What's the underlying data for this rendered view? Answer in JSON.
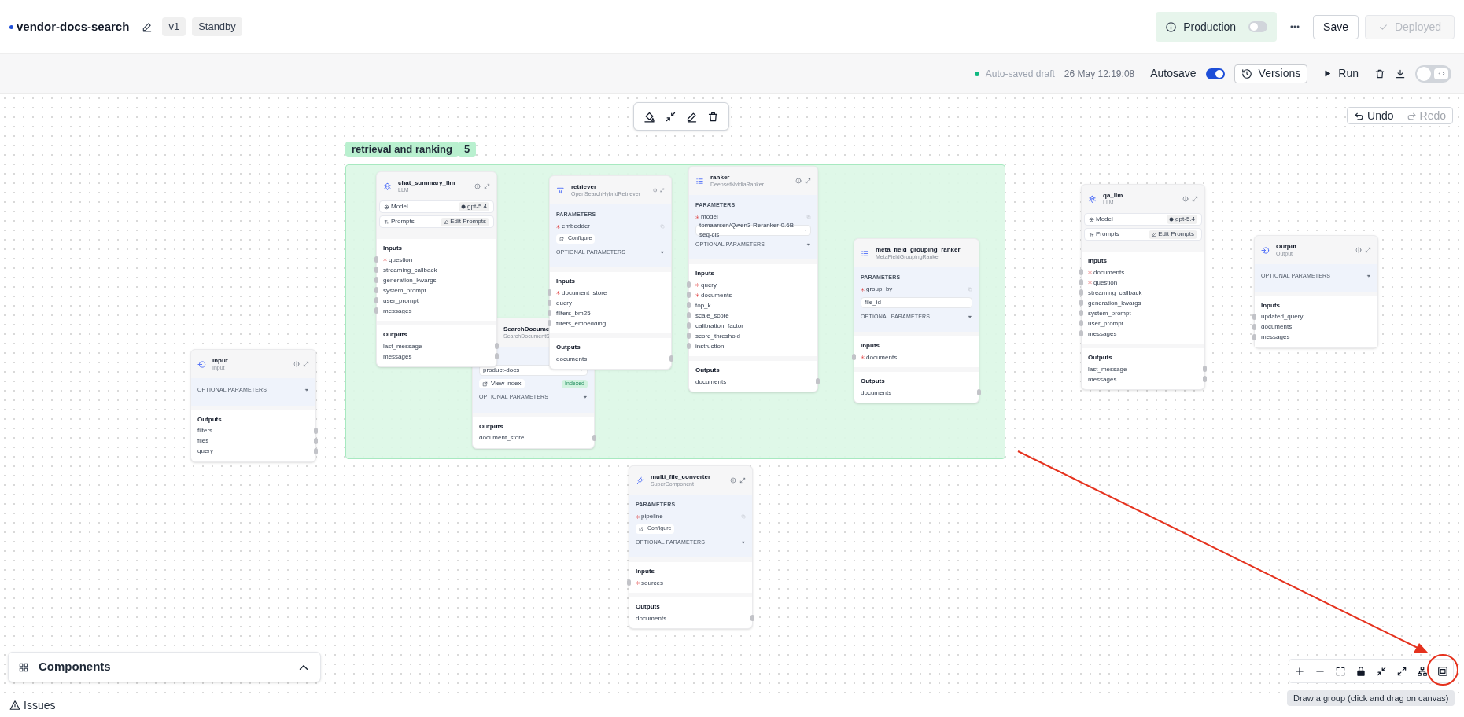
{
  "header": {
    "pipeline_name": "vendor-docs-search",
    "version": "v1",
    "status": "Standby",
    "production": {
      "label": "Production",
      "on": false
    },
    "save": "Save",
    "deploy": {
      "label": "Deployed",
      "disabled": true
    }
  },
  "toolbar": {
    "autosave_status": "Auto-saved draft",
    "saved_at": "26 May 12:19:08",
    "autosave": {
      "label": "Autosave",
      "on": true
    },
    "versions": "Versions",
    "run": "Run",
    "code_view": {
      "on": false
    }
  },
  "canvas": {
    "group": {
      "label": "retrieval and ranking",
      "count": "5"
    },
    "undo": {
      "label": "Undo",
      "disabled": false
    },
    "redo": {
      "label": "Redo",
      "disabled": true
    },
    "nodes": [
      {
        "kind": "input",
        "title": "Input",
        "subtitle": "Input",
        "optional_parameters": "OPTIONAL PARAMETERS",
        "outputs": {
          "heading": "Outputs",
          "ports": [
            "filters",
            "files",
            "query"
          ]
        }
      },
      {
        "kind": "llm",
        "title": "chat_summary_llm",
        "subtitle": "LLM",
        "model": {
          "label": "Model",
          "value": "gpt-5.4"
        },
        "prompts": {
          "label": "Prompts",
          "button": "Edit Prompts"
        },
        "inputs": {
          "heading": "Inputs",
          "ports": [
            {
              "name": "question",
              "required": true
            },
            {
              "name": "streaming_callback",
              "required": false
            },
            {
              "name": "generation_kwargs",
              "required": false
            },
            {
              "name": "system_prompt",
              "required": false
            },
            {
              "name": "user_prompt",
              "required": false
            },
            {
              "name": "messages",
              "required": false
            }
          ]
        },
        "outputs": {
          "heading": "Outputs",
          "ports": [
            "last_message",
            "messages"
          ]
        }
      },
      {
        "kind": "retriever",
        "title": "retriever",
        "subtitle": "OpenSearchHybridRetriever",
        "parameters": {
          "heading": "PARAMETERS",
          "items": [
            {
              "name": "embedder",
              "required": true,
              "control": {
                "kind": "button",
                "label": "Configure"
              }
            }
          ]
        },
        "optional_parameters": "OPTIONAL PARAMETERS",
        "inputs": {
          "heading": "Inputs",
          "ports": [
            {
              "name": "document_store",
              "required": true
            },
            {
              "name": "query",
              "required": false
            },
            {
              "name": "filters_bm25",
              "required": false
            },
            {
              "name": "filters_embedding",
              "required": false
            }
          ]
        },
        "outputs": {
          "heading": "Outputs",
          "ports": [
            "documents"
          ]
        }
      },
      {
        "kind": "document_store",
        "title": "SearchDocume",
        "subtitle": "SearchDocumentS",
        "parameters": {
          "items": [
            {
              "control": {
                "kind": "select",
                "value": "product-docs"
              },
              "link": "View index",
              "badge": "Indexed"
            }
          ]
        },
        "optional_parameters": "OPTIONAL PARAMETERS",
        "outputs": {
          "heading": "Outputs",
          "ports": [
            "document_store"
          ]
        }
      },
      {
        "kind": "ranker",
        "title": "ranker",
        "subtitle": "DeepsetNvidiaRanker",
        "parameters": {
          "heading": "PARAMETERS",
          "items": [
            {
              "name": "model",
              "required": true,
              "control": {
                "kind": "select",
                "value": "tomaarsen/Qwen3-Reranker-0.6B-seq-cls"
              }
            }
          ]
        },
        "optional_parameters": "OPTIONAL PARAMETERS",
        "inputs": {
          "heading": "Inputs",
          "ports": [
            {
              "name": "query",
              "required": true
            },
            {
              "name": "documents",
              "required": true
            },
            {
              "name": "top_k",
              "required": false
            },
            {
              "name": "scale_score",
              "required": false
            },
            {
              "name": "calibration_factor",
              "required": false
            },
            {
              "name": "score_threshold",
              "required": false
            },
            {
              "name": "instruction",
              "required": false
            }
          ]
        },
        "outputs": {
          "heading": "Outputs",
          "ports": [
            "documents"
          ]
        }
      },
      {
        "kind": "ranker",
        "title": "meta_field_grouping_ranker",
        "subtitle": "MetaFieldGroupingRanker",
        "parameters": {
          "heading": "PARAMETERS",
          "items": [
            {
              "name": "group_by",
              "required": true,
              "control": {
                "kind": "text",
                "value": "file_id"
              }
            }
          ]
        },
        "optional_parameters": "OPTIONAL PARAMETERS",
        "inputs": {
          "heading": "Inputs",
          "ports": [
            {
              "name": "documents",
              "required": true
            }
          ]
        },
        "outputs": {
          "heading": "Outputs",
          "ports": [
            "documents"
          ]
        }
      },
      {
        "kind": "supercomponent",
        "title": "multi_file_converter",
        "subtitle": "SuperComponent",
        "parameters": {
          "heading": "PARAMETERS",
          "items": [
            {
              "name": "pipeline",
              "required": true,
              "control": {
                "kind": "button",
                "label": "Configure"
              }
            }
          ]
        },
        "optional_parameters": "OPTIONAL PARAMETERS",
        "inputs": {
          "heading": "Inputs",
          "ports": [
            {
              "name": "sources",
              "required": true
            }
          ]
        },
        "outputs": {
          "heading": "Outputs",
          "ports": [
            "documents"
          ]
        }
      },
      {
        "kind": "llm",
        "title": "qa_llm",
        "subtitle": "LLM",
        "model": {
          "label": "Model",
          "value": "gpt-5.4"
        },
        "prompts": {
          "label": "Prompts",
          "button": "Edit Prompts"
        },
        "inputs": {
          "heading": "Inputs",
          "ports": [
            {
              "name": "documents",
              "required": true
            },
            {
              "name": "question",
              "required": true
            },
            {
              "name": "streaming_callback",
              "required": false
            },
            {
              "name": "generation_kwargs",
              "required": false
            },
            {
              "name": "system_prompt",
              "required": false
            },
            {
              "name": "user_prompt",
              "required": false
            },
            {
              "name": "messages",
              "required": false
            }
          ]
        },
        "outputs": {
          "heading": "Outputs",
          "ports": [
            "last_message",
            "messages"
          ]
        }
      },
      {
        "kind": "output",
        "title": "Output",
        "subtitle": "Output",
        "optional_parameters": "OPTIONAL PARAMETERS",
        "inputs": {
          "heading": "Inputs",
          "ports": [
            {
              "name": "updated_query",
              "required": false
            },
            {
              "name": "documents",
              "required": false
            },
            {
              "name": "messages",
              "required": false
            }
          ]
        }
      }
    ],
    "tooltip": "Draw a group (click and drag on canvas)"
  },
  "components_panel": {
    "label": "Components",
    "expanded": false
  },
  "status_bar": {
    "issues": "Issues"
  }
}
